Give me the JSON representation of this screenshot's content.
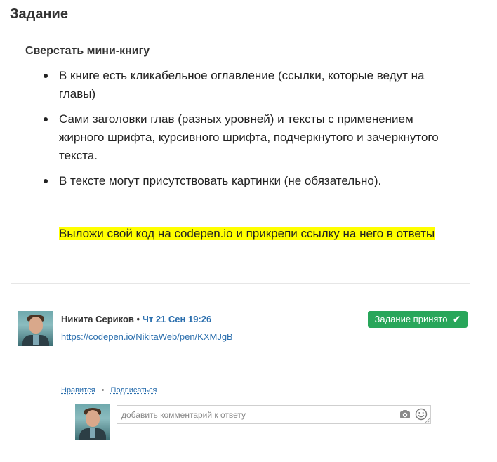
{
  "page": {
    "title": "Задание"
  },
  "task": {
    "title": "Сверстать мини-книгу",
    "items": [
      " В книге есть кликабельное оглавление (ссылки, которые ведут на главы)",
      " Сами заголовки глав (разных уровней) и тексты с применением жирного шрифта,   курсивного шрифта, подчеркнутого и зачеркнутого текста.",
      " В тексте могут присутствовать картинки (не обязательно)."
    ],
    "highlight": "Выложи свой код на codepen.io и прикрепи ссылку на него в ответы"
  },
  "answer": {
    "author": "Никита Сериков",
    "separator": "•",
    "date": "Чт 21 Сен 19:26",
    "link": "https://codepen.io/NikitaWeb/pen/KXMJgB",
    "status": "Задание принято",
    "status_color": "#28a65a",
    "actions": {
      "like": "Нравится",
      "separator": "•",
      "subscribe": "Подписаться"
    }
  },
  "comment": {
    "placeholder": "добавить комментарий к ответу",
    "icons": [
      "camera-icon",
      "smile-icon"
    ]
  },
  "colors": {
    "link": "#2a6ead",
    "highlight": "#ffff00"
  }
}
